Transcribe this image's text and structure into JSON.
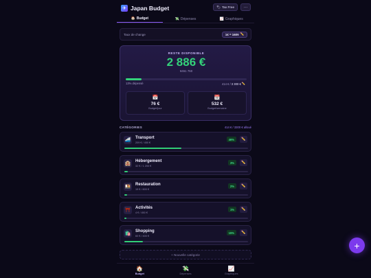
{
  "app": {
    "title": "Japan Budget",
    "logo_icon": "flag-icon"
  },
  "header": {
    "tax_free_label": "Tax Free",
    "more_label": "···"
  },
  "tabs": [
    {
      "label": "Budget",
      "icon": "🏠"
    },
    {
      "label": "Dépenses",
      "icon": "💸"
    },
    {
      "label": "Graphiques",
      "icon": "📈"
    }
  ],
  "exchange": {
    "label": "Taux de change",
    "value": "1€ = 160¥"
  },
  "summary": {
    "label": "RESTE DISPONIBLE",
    "amount": "2 886 €",
    "yen": "¥461 760",
    "spent_fraction": 0.13,
    "spent_pct_text": "13% dépensé",
    "spent_of_prefix": "414 € /",
    "spent_of_total": "3 300 €",
    "stats": [
      {
        "icon": "📅",
        "value": "76 €",
        "label": "Budget/jour"
      },
      {
        "icon": "📆",
        "value": "532 €",
        "label": "Budget/semaine"
      }
    ]
  },
  "categories_section": {
    "title": "CATÉGORIES",
    "allocated": "414 € / 3300 € alloué"
  },
  "categories": [
    {
      "icon": "🚄",
      "name": "Transport",
      "sub": "209 € / 450 €",
      "pct": "46%",
      "fraction": 0.46
    },
    {
      "icon": "🏨",
      "name": "Hébergement",
      "sub": "32 € / 1 200 €",
      "pct": "3%",
      "fraction": 0.03
    },
    {
      "icon": "🍱",
      "name": "Restauration",
      "sub": "19 € / 800 €",
      "pct": "2%",
      "fraction": 0.02
    },
    {
      "icon": "⛩️",
      "name": "Activités",
      "sub": "4 € / 450 €",
      "pct": "1%",
      "fraction": 0.01
    },
    {
      "icon": "🛍️",
      "name": "Shopping",
      "sub": "60 € / 400 €",
      "pct": "15%",
      "fraction": 0.15
    }
  ],
  "new_category_label": "+ Nouvelle catégorie",
  "bottom_nav": [
    {
      "icon": "🏠",
      "label": "Budget"
    },
    {
      "icon": "💸",
      "label": "Dépenses"
    },
    {
      "icon": "📈",
      "label": "Graphiques"
    }
  ],
  "fab_label": "+",
  "colors": {
    "accent": "#7c3aed",
    "positive": "#34d27a",
    "background": "#0b0918"
  }
}
